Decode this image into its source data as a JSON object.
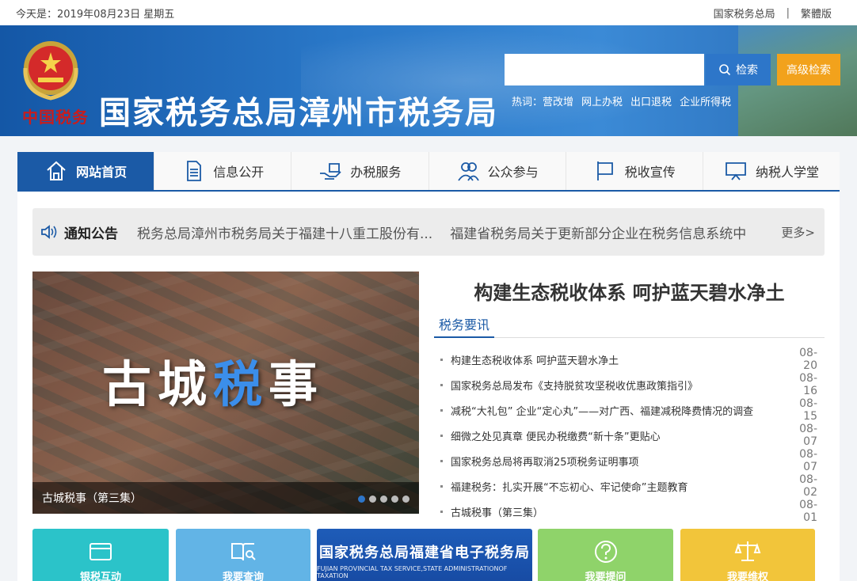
{
  "topbar": {
    "date": "今天是：2019年08月23日 星期五",
    "links": [
      "国家税务总局",
      "繁體版"
    ],
    "separator": "|"
  },
  "header": {
    "emblem_text": "中国税务",
    "title": "国家税务总局漳州市税务局",
    "search": {
      "placeholder": "",
      "button": "检索",
      "advanced": "高级检索"
    },
    "hotwords": {
      "label": "热词：",
      "items": [
        "营改增",
        "网上办税",
        "出口退税",
        "企业所得税"
      ]
    }
  },
  "nav": [
    {
      "label": "网站首页",
      "icon": "home-icon",
      "active": true
    },
    {
      "label": "信息公开",
      "icon": "document-icon",
      "active": false
    },
    {
      "label": "办税服务",
      "icon": "hand-service-icon",
      "active": false
    },
    {
      "label": "公众参与",
      "icon": "people-icon",
      "active": false
    },
    {
      "label": "税收宣传",
      "icon": "flag-icon",
      "active": false
    },
    {
      "label": "纳税人学堂",
      "icon": "screen-icon",
      "active": false
    }
  ],
  "notice": {
    "label": "通知公告",
    "items": [
      "税务总局漳州市税务局关于福建十八重工股份有...",
      "福建省税务局关于更新部分企业在税务信息系统中"
    ],
    "more": "更多>"
  },
  "carousel": {
    "art_text_1": "古城",
    "art_text_2": "税",
    "art_text_3": "事",
    "caption": "古城税事（第三集）",
    "slides": 5,
    "active_index": 0
  },
  "news": {
    "headline": "构建生态税收体系 呵护蓝天碧水净土",
    "tab": "税务要讯",
    "items": [
      {
        "title": "构建生态税收体系 呵护蓝天碧水净土",
        "date": "08-20"
      },
      {
        "title": "国家税务总局发布《支持脱贫攻坚税收优惠政策指引》",
        "date": "08-16"
      },
      {
        "title": "减税“大礼包” 企业“定心丸”——对广西、福建减税降费情况的调查",
        "date": "08-15"
      },
      {
        "title": "细微之处见真章 便民办税缴费“新十条”更贴心",
        "date": "08-07"
      },
      {
        "title": "国家税务总局将再取消25项税务证明事项",
        "date": "08-07"
      },
      {
        "title": "福建税务：扎实开展“不忘初心、牢记使命”主题教育",
        "date": "08-02"
      },
      {
        "title": "古城税事（第三集）",
        "date": "08-01"
      }
    ]
  },
  "tiles": [
    {
      "label": "银税互动",
      "icon": "card-icon",
      "color": "#2bc3c9",
      "badge": "银税"
    },
    {
      "label": "我要查询",
      "icon": "book-search-icon",
      "color": "#62b4e6"
    },
    {
      "label": "国家税务总局福建省电子税务局",
      "sublabel": "FUJIAN PROVINCIAL TAX SERVICE,STATE ADMINISTRATIONOF TAXATION",
      "icon": "",
      "color": "#1e5cb8"
    },
    {
      "label": "我要提问",
      "icon": "question-icon",
      "color": "#8fd36a"
    },
    {
      "label": "我要维权",
      "icon": "scale-icon",
      "color": "#f2c53a"
    }
  ],
  "colors": {
    "primary": "#1b5aa6",
    "accent": "#f2a21c",
    "header": "#1f66b5"
  }
}
